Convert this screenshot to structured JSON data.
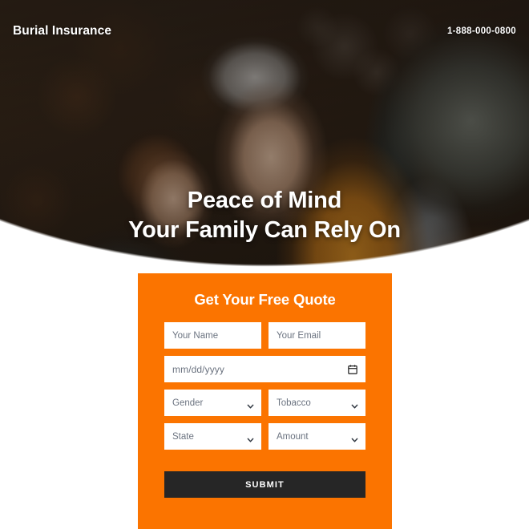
{
  "header": {
    "logo": "Burial Insurance",
    "phone": "1-888-000-0800"
  },
  "hero": {
    "headline_line1": "Peace of Mind",
    "headline_line2": "Your Family Can Rely On",
    "image_alt": "Smiling senior couple hugging outdoors with hiking backpacks"
  },
  "form": {
    "title": "Get Your Free Quote",
    "name_placeholder": "Your Name",
    "email_placeholder": "Your Email",
    "dob_placeholder": "mm/dd/yyyy",
    "gender_selected": "Gender",
    "tobacco_selected": "Tobacco",
    "state_selected": "State",
    "amount_selected": "Amount",
    "submit_label": "SUBMIT"
  },
  "colors": {
    "accent_orange": "#fb7400",
    "submit_dark": "#262626",
    "field_white": "#ffffff",
    "placeholder_grey": "#6b7380"
  }
}
